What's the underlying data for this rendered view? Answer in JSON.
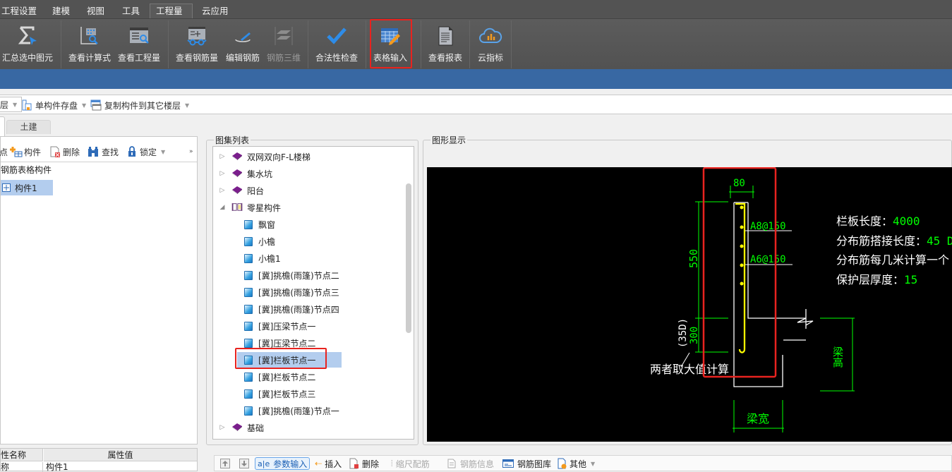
{
  "menu": {
    "tabs": [
      {
        "label": "工程设置"
      },
      {
        "label": "建模"
      },
      {
        "label": "视图"
      },
      {
        "label": "工具"
      },
      {
        "label": "工程量",
        "active": true
      },
      {
        "label": "云应用"
      }
    ]
  },
  "ribbon": {
    "buttons": [
      {
        "label": "汇总选中图元",
        "icon": "sigma-select-icon"
      },
      {
        "label": "查看计算式",
        "icon": "view-formula-icon"
      },
      {
        "label": "查看工程量",
        "icon": "view-quantity-icon"
      },
      {
        "label": "查看钢筋量",
        "icon": "view-rebar-icon"
      },
      {
        "label": "编辑钢筋",
        "icon": "edit-rebar-icon"
      },
      {
        "label": "钢筋三维",
        "icon": "rebar-3d-icon",
        "disabled": true
      },
      {
        "label": "合法性检查",
        "icon": "checkmark-icon"
      },
      {
        "label": "表格输入",
        "icon": "table-input-icon",
        "highlighted": true
      },
      {
        "label": "查看报表",
        "icon": "report-icon"
      },
      {
        "label": "云指标",
        "icon": "cloud-index-icon"
      }
    ],
    "accent": "#2e8ce8",
    "highlight_color": "#e8231f"
  },
  "toolbar": {
    "floor_select": "层",
    "save_component": "单构件存盘",
    "copy_to_floor": "复制构件到其它楼层"
  },
  "tabs": {
    "civil": "土建"
  },
  "left_panel": {
    "toolbar": {
      "partial": "点",
      "component": "构件",
      "delete": "删除",
      "find": "查找",
      "lock": "锁定",
      "more": "»"
    },
    "tree_root": "钢筋表格构件",
    "selected_item": "构件1",
    "props": {
      "col_name": "性名称",
      "col_value": "属性值",
      "row_name": "称",
      "row_value": "构件1"
    }
  },
  "atlas": {
    "title": "图集列表",
    "items": [
      {
        "label": "双网双向F-L楼梯",
        "type": "book",
        "expand": "collapsed",
        "level": 0
      },
      {
        "label": "集水坑",
        "type": "book",
        "expand": "collapsed",
        "level": 0
      },
      {
        "label": "阳台",
        "type": "book",
        "expand": "collapsed",
        "level": 0
      },
      {
        "label": "零星构件",
        "type": "open-book",
        "expand": "expanded",
        "level": 0
      },
      {
        "label": "飘窗",
        "type": "page",
        "level": 1
      },
      {
        "label": "小檐",
        "type": "page",
        "level": 1
      },
      {
        "label": "小檐1",
        "type": "page",
        "level": 1
      },
      {
        "label": "[冀]挑檐(雨篷)节点二",
        "type": "page",
        "level": 1
      },
      {
        "label": "[冀]挑檐(雨篷)节点三",
        "type": "page",
        "level": 1
      },
      {
        "label": "[冀]挑檐(雨篷)节点四",
        "type": "page",
        "level": 1
      },
      {
        "label": "[冀]压梁节点一",
        "type": "page",
        "level": 1
      },
      {
        "label": "[冀]压梁节点二",
        "type": "page",
        "level": 1
      },
      {
        "label": "[冀]栏板节点一",
        "type": "page",
        "level": 1,
        "selected": true
      },
      {
        "label": "[冀]栏板节点二",
        "type": "page",
        "level": 1
      },
      {
        "label": "[冀]栏板节点三",
        "type": "page",
        "level": 1
      },
      {
        "label": "[冀]挑檐(雨篷)节点一",
        "type": "page",
        "level": 1
      },
      {
        "label": "基础",
        "type": "book",
        "expand": "collapsed",
        "level": 0
      }
    ]
  },
  "drawing": {
    "title": "图形显示",
    "dim_width": "80",
    "rebar_label_1": "A8@150",
    "rebar_label_2": "A6@150",
    "dim_height_upper": "550",
    "dim_height_lower": "300",
    "dim_anchor": "(35D)",
    "note": "两者取大值计算",
    "beam_height": "梁高",
    "beam_width": "梁宽",
    "params": [
      {
        "label": "栏板长度：",
        "value": "4000"
      },
      {
        "label": "分布筋搭接长度：",
        "value": "45 D"
      },
      {
        "label": "分布筋每几米计算一个",
        "value": ""
      },
      {
        "label": "保护层厚度：",
        "value": "15"
      }
    ],
    "colors": {
      "dimension": "#00ff00",
      "outline": "#ffffff",
      "rebar": "#ffff00",
      "background": "#000000"
    }
  },
  "bottom_toolbar": {
    "move_up": "上移",
    "move_down": "下移",
    "param_input": "参数输入",
    "insert": "插入",
    "delete": "删除",
    "scale_rebar": "缩尺配筋",
    "rebar_info": "钢筋信息",
    "rebar_library": "钢筋图库",
    "other": "其他"
  }
}
